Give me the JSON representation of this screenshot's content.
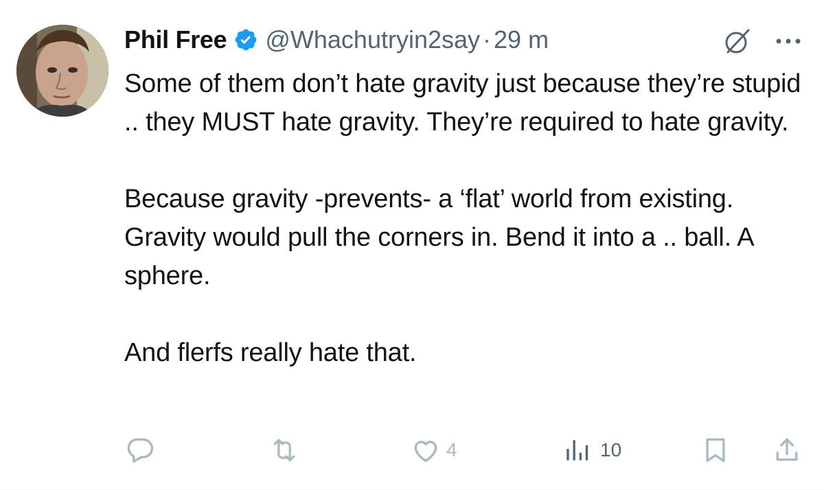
{
  "author": {
    "display_name": "Phil Free",
    "handle": "@Whachutryin2say",
    "separator": "·",
    "time": "29 m",
    "verified": true
  },
  "tweet": {
    "paragraphs": [
      "Some of them don’t hate gravity just because they’re stupid .. they MUST hate gravity. They’re required to hate gravity.",
      "Because gravity -prevents- a ‘flat’ world from existing. Gravity would pull the corners in. Bend it into a .. ball. A sphere.",
      "And flerfs really hate that."
    ]
  },
  "metrics": {
    "replies": "",
    "reposts": "",
    "likes": "4",
    "views": "10"
  },
  "icons": {
    "verified": "verified-badge-icon",
    "grok": "grok-icon",
    "more": "more-icon",
    "reply": "reply-icon",
    "repost": "repost-icon",
    "like": "heart-icon",
    "views": "views-bar-chart-icon",
    "bookmark": "bookmark-icon",
    "share": "share-icon"
  },
  "colors": {
    "text": "#0f1419",
    "secondary": "#536471",
    "verified": "#1d9bf0",
    "action_faded": "#aab8c2"
  }
}
